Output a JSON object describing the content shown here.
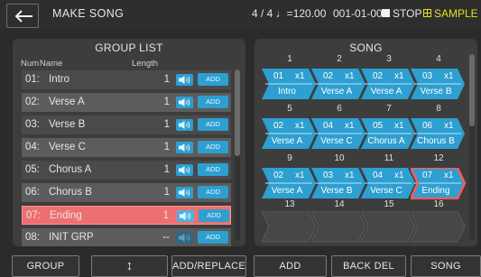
{
  "header": {
    "title": "MAKE SONG",
    "meter_tempo": "4 / 4 ♩=120.00",
    "position": "001-01-000",
    "transport": "STOP",
    "pad_mode": "SAMPLE PAD"
  },
  "group_list": {
    "title": "GROUP LIST",
    "col_num": "Num",
    "col_name": "Name",
    "col_length": "Length",
    "add_label": "ADD",
    "rows": [
      {
        "num": "01:",
        "name": "Intro",
        "length": "1"
      },
      {
        "num": "02:",
        "name": "Verse A",
        "length": "1"
      },
      {
        "num": "03:",
        "name": "Verse B",
        "length": "1"
      },
      {
        "num": "04:",
        "name": "Verse C",
        "length": "1"
      },
      {
        "num": "05:",
        "name": "Chorus A",
        "length": "1"
      },
      {
        "num": "06:",
        "name": "Chorus B",
        "length": "1"
      },
      {
        "num": "07:",
        "name": "Ending",
        "length": "1"
      },
      {
        "num": "08:",
        "name": "INIT GRP",
        "length": "--"
      }
    ],
    "selected_row": 6
  },
  "song": {
    "title": "SONG",
    "bar_numbers": [
      "1",
      "2",
      "3",
      "4",
      "5",
      "6",
      "7",
      "8",
      "9",
      "10",
      "11",
      "12",
      "13",
      "14",
      "15",
      "16"
    ],
    "slots": [
      {
        "num": "01",
        "rep": "x1",
        "name": "Intro"
      },
      {
        "num": "02",
        "rep": "x1",
        "name": "Verse A"
      },
      {
        "num": "02",
        "rep": "x1",
        "name": "Verse A"
      },
      {
        "num": "03",
        "rep": "x1",
        "name": "Verse B"
      },
      {
        "num": "02",
        "rep": "x1",
        "name": "Verse A"
      },
      {
        "num": "04",
        "rep": "x1",
        "name": "Verse C"
      },
      {
        "num": "05",
        "rep": "x1",
        "name": "Chorus A"
      },
      {
        "num": "06",
        "rep": "x1",
        "name": "Chorus B"
      },
      {
        "num": "02",
        "rep": "x1",
        "name": "Verse A"
      },
      {
        "num": "03",
        "rep": "x1",
        "name": "Verse B"
      },
      {
        "num": "04",
        "rep": "x1",
        "name": "Verse C"
      },
      {
        "num": "07",
        "rep": "x1",
        "name": "Ending"
      },
      {
        "num": "",
        "rep": "",
        "name": ""
      },
      {
        "num": "",
        "rep": "",
        "name": ""
      },
      {
        "num": "",
        "rep": "",
        "name": ""
      },
      {
        "num": "",
        "rep": "",
        "name": ""
      }
    ],
    "selected_slot": 11
  },
  "footer": {
    "group": "GROUP",
    "move": "↕",
    "add_replace": "ADD/REPLACE",
    "add": "ADD",
    "back_del": "BACK DEL",
    "song": "SONG"
  },
  "colors": {
    "accent_blue": "#2d9fd0",
    "selected_red": "#ee6f6f",
    "pad_yellow": "#e0e020"
  },
  "icons": {
    "back": "back-arrow-icon",
    "speaker": "speaker-icon",
    "grid": "grid-icon",
    "stop": "stop-square-icon"
  }
}
